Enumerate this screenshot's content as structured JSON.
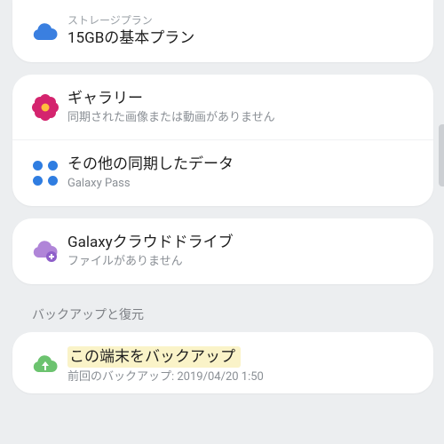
{
  "storage": {
    "label": "ストレージプラン",
    "plan": "15GBの基本プラン"
  },
  "sync": {
    "gallery": {
      "title": "ギャラリー",
      "sub": "同期された画像または動画がありません"
    },
    "other": {
      "title": "その他の同期したデータ",
      "sub": "Galaxy Pass"
    }
  },
  "drive": {
    "title": "Galaxyクラウドドライブ",
    "sub": "ファイルがありません"
  },
  "backup": {
    "section": "バックアップと復元",
    "this_device": {
      "title": "この端末をバックアップ",
      "sub": "前回のバックアップ: 2019/04/20 1:50"
    }
  },
  "colors": {
    "cloud": "#3a7fe0",
    "flower": "#d4246e",
    "dots": "#2f7de1",
    "drive": "#b085d8",
    "backup": "#6cc36f"
  }
}
